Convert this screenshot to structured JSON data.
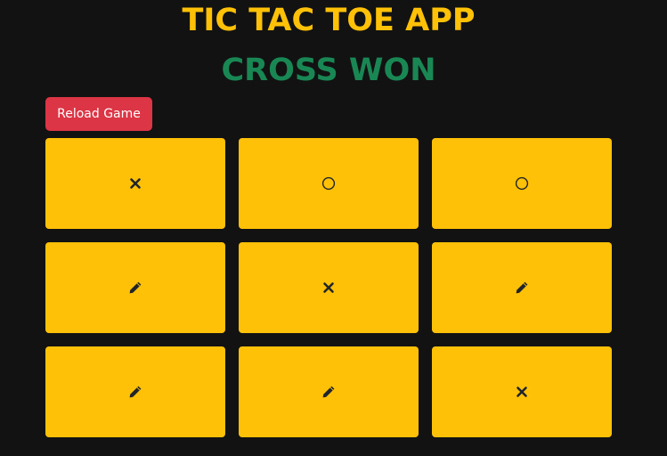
{
  "header": {
    "title": "TIC TAC TOE APP",
    "status": "CROSS WON"
  },
  "controls": {
    "reload_label": "Reload Game"
  },
  "colors": {
    "background": "#121212",
    "title": "#ffc107",
    "status": "#198754",
    "button": "#dc3545",
    "cell": "#ffc107",
    "mark": "#212529"
  },
  "board": {
    "cells": [
      {
        "state": "cross",
        "icon": "cross-icon"
      },
      {
        "state": "circle",
        "icon": "circle-icon"
      },
      {
        "state": "circle",
        "icon": "circle-icon"
      },
      {
        "state": "empty",
        "icon": "pencil-icon"
      },
      {
        "state": "cross",
        "icon": "cross-icon"
      },
      {
        "state": "empty",
        "icon": "pencil-icon"
      },
      {
        "state": "empty",
        "icon": "pencil-icon"
      },
      {
        "state": "empty",
        "icon": "pencil-icon"
      },
      {
        "state": "cross",
        "icon": "cross-icon"
      }
    ]
  }
}
